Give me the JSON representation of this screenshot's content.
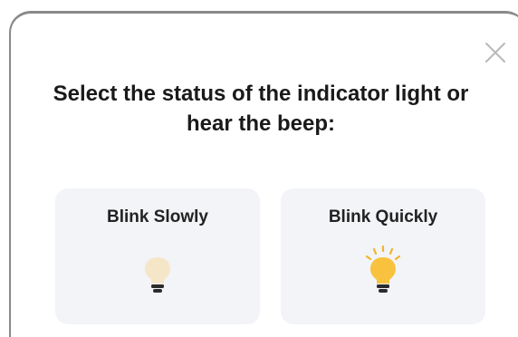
{
  "dialog": {
    "title": "Select the status of the indicator light or hear the beep:",
    "close_icon": "close-icon"
  },
  "options": [
    {
      "label": "Blink Slowly",
      "icon": "dim-bulb-icon",
      "bulb_color": "#f5e6c8"
    },
    {
      "label": "Blink Quickly",
      "icon": "bright-bulb-icon",
      "bulb_color": "#f8c23e"
    }
  ]
}
